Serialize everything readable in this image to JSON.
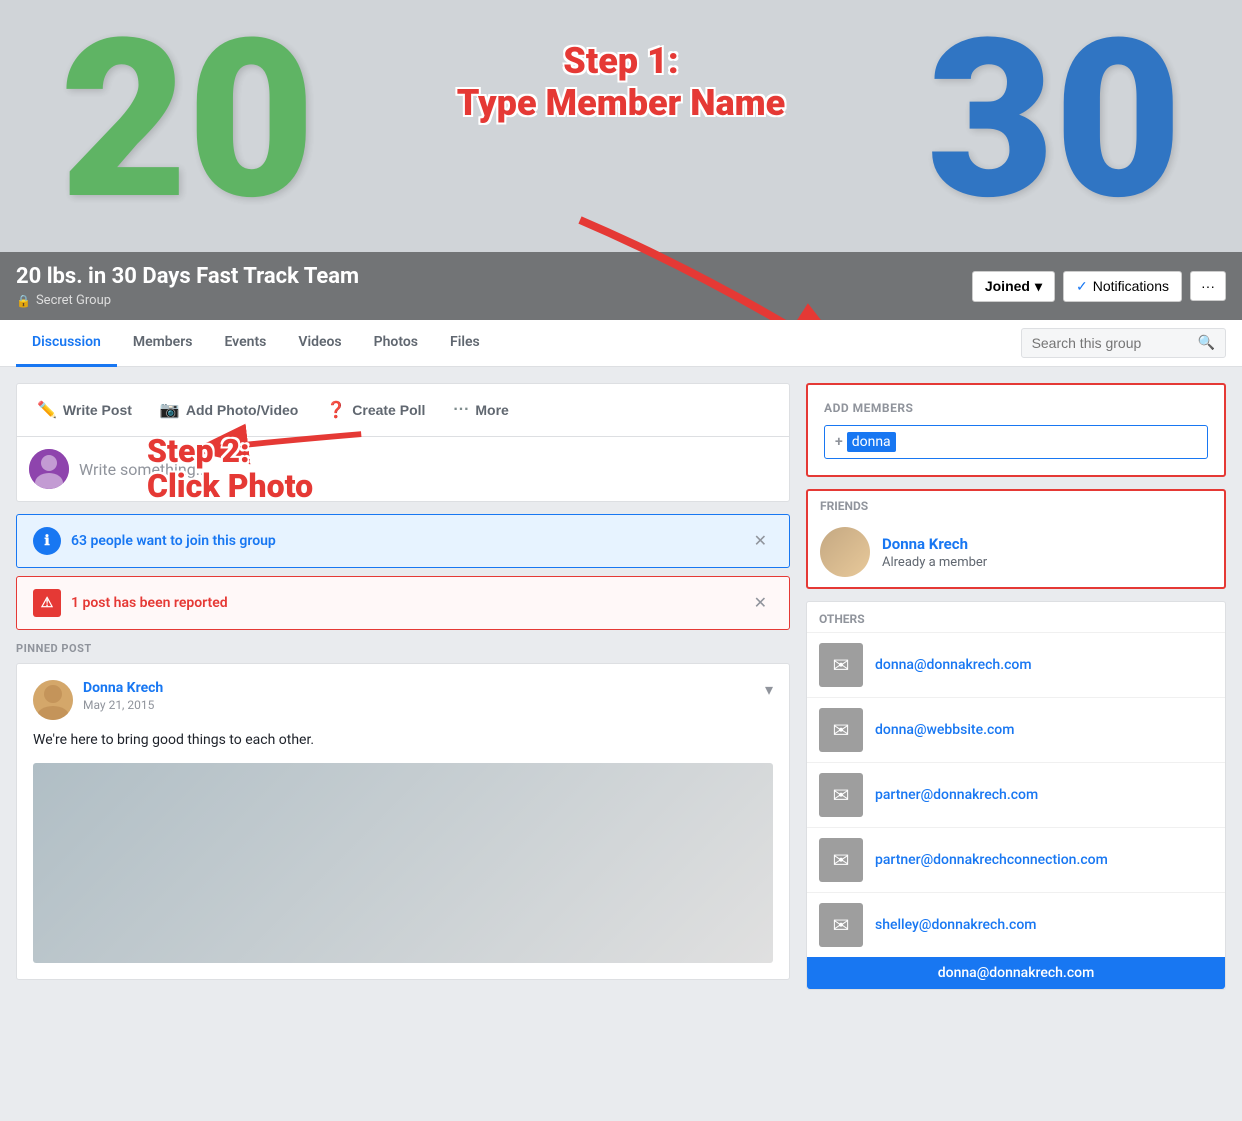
{
  "cover": {
    "title": "20 lbs. in 30 Days Fast Track Team",
    "subtitle": "Secret Group",
    "num_left": "20",
    "num_right": "30",
    "btn_joined": "Joined",
    "btn_notifications": "Notifications",
    "btn_more": "···"
  },
  "step1": {
    "line1": "Step 1:",
    "line2": "Type Member Name"
  },
  "step2": {
    "line1": "Step 2:",
    "line2": "Click Photo"
  },
  "nav": {
    "tabs": [
      "Discussion",
      "Members",
      "Events",
      "Videos",
      "Photos",
      "Files"
    ],
    "active": "Discussion",
    "search_placeholder": "Search this group"
  },
  "composer": {
    "write_post": "Write Post",
    "add_photo": "Add Photo/Video",
    "create_poll": "Create Poll",
    "more": "More",
    "placeholder": "Write something..."
  },
  "banners": {
    "join_text": "63 people want to join this group",
    "report_text": "1 post has been reported"
  },
  "pinned": {
    "label": "PINNED POST",
    "author": "Donna Krech",
    "date": "May 21, 2015",
    "content": "We're here to bring good things to each other."
  },
  "add_members": {
    "title": "ADD MEMBERS",
    "input_value": "donna",
    "plus_label": "+"
  },
  "friends": {
    "section_label": "Friends",
    "name": "Donna Krech",
    "status": "Already a member"
  },
  "others": {
    "section_label": "Others",
    "emails": [
      "donna@donnakrech.com",
      "donna@webbsite.com",
      "partner@donnakrech.com",
      "partner@donnakrechconnection.com",
      "shelley@donnakrech.com",
      "donna@donnakrech.com"
    ]
  }
}
